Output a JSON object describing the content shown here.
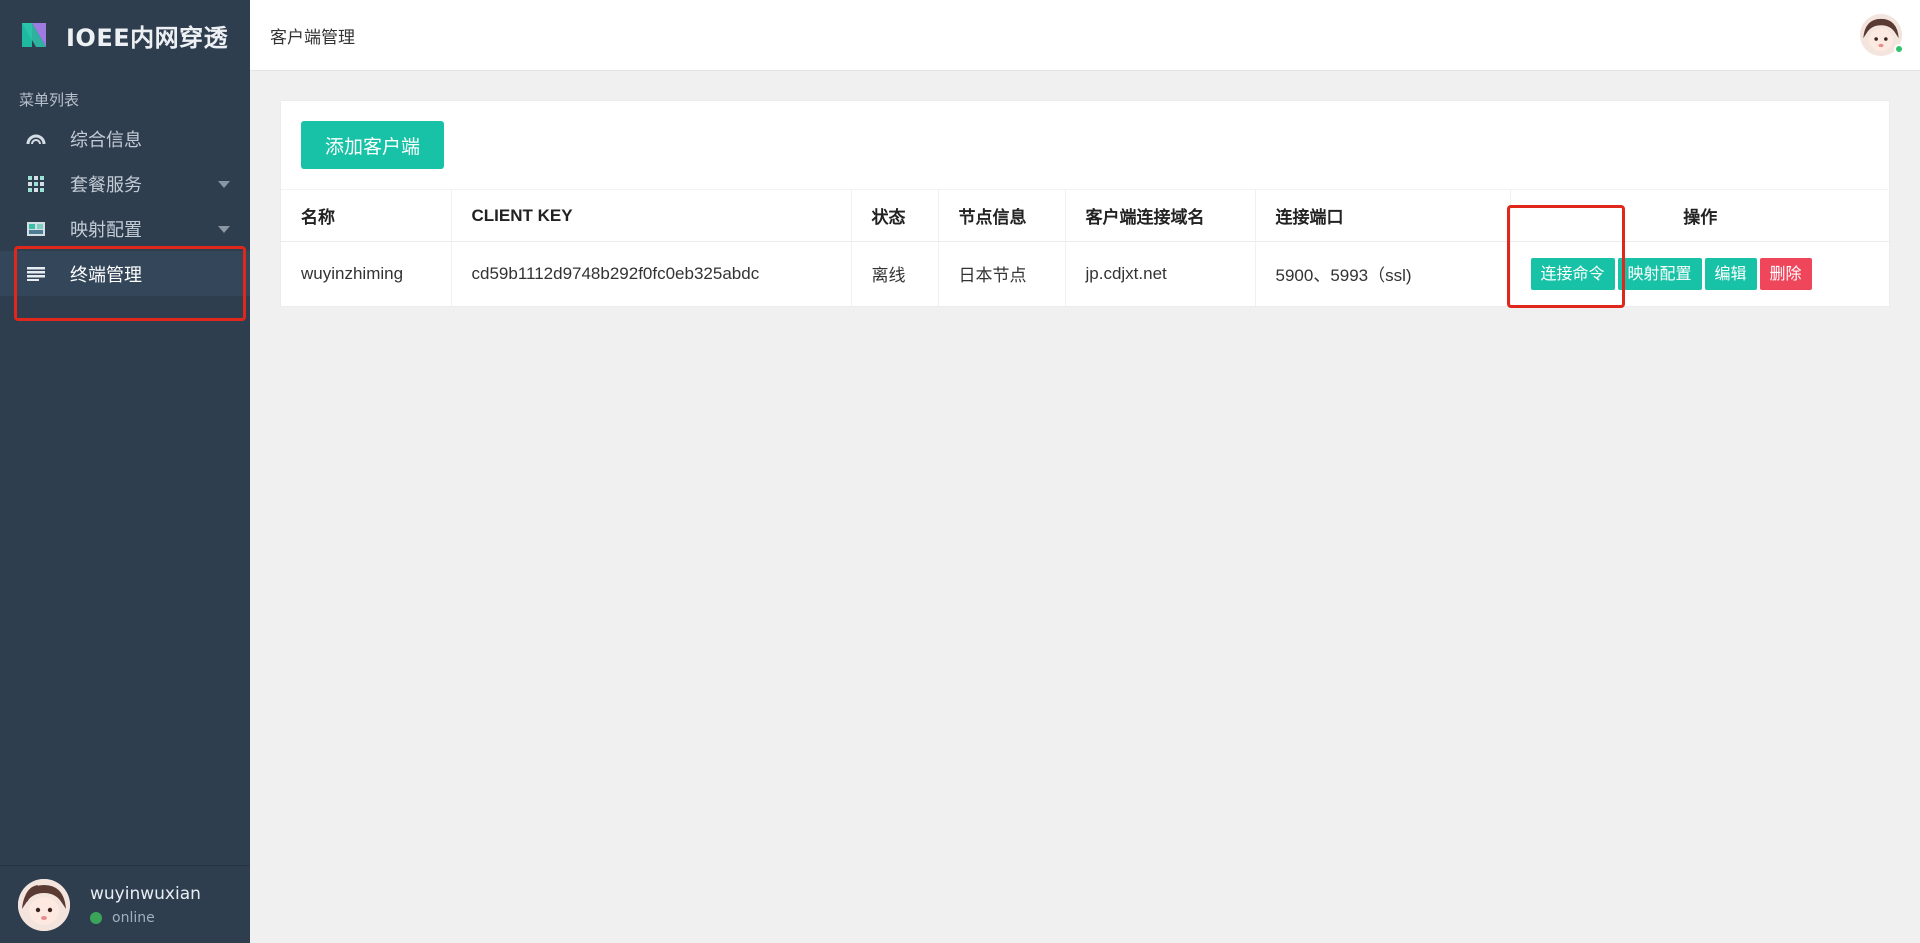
{
  "brand": {
    "title": "IOEE内网穿透"
  },
  "sidebar": {
    "caption": "菜单列表",
    "items": [
      {
        "label": "综合信息",
        "icon": "gauge-icon"
      },
      {
        "label": "套餐服务",
        "icon": "grid-icon"
      },
      {
        "label": "映射配置",
        "icon": "image-icon"
      },
      {
        "label": "终端管理",
        "icon": "list-icon"
      }
    ],
    "user": {
      "name": "wuyinwuxian",
      "status": "online"
    }
  },
  "header": {
    "title": "客户端管理"
  },
  "main": {
    "add_button": "添加客户端",
    "columns": [
      "名称",
      "CLIENT KEY",
      "状态",
      "节点信息",
      "客户端连接域名",
      "连接端口",
      "操作"
    ],
    "rows": [
      {
        "name": "wuyinzhiming",
        "client_key": "cd59b1112d9748b292f0fc0eb325abdc",
        "status": "离线",
        "node": "日本节点",
        "domain": "jp.cdjxt.net",
        "ports": "5900、5993（ssl)"
      }
    ],
    "actions": [
      "连接命令",
      "映射配置",
      "编辑",
      "删除"
    ]
  },
  "colors": {
    "sidebar_bg": "#2f3e4f",
    "accent": "#17c2a6",
    "danger": "#f0465c",
    "highlight": "#e0271c"
  }
}
